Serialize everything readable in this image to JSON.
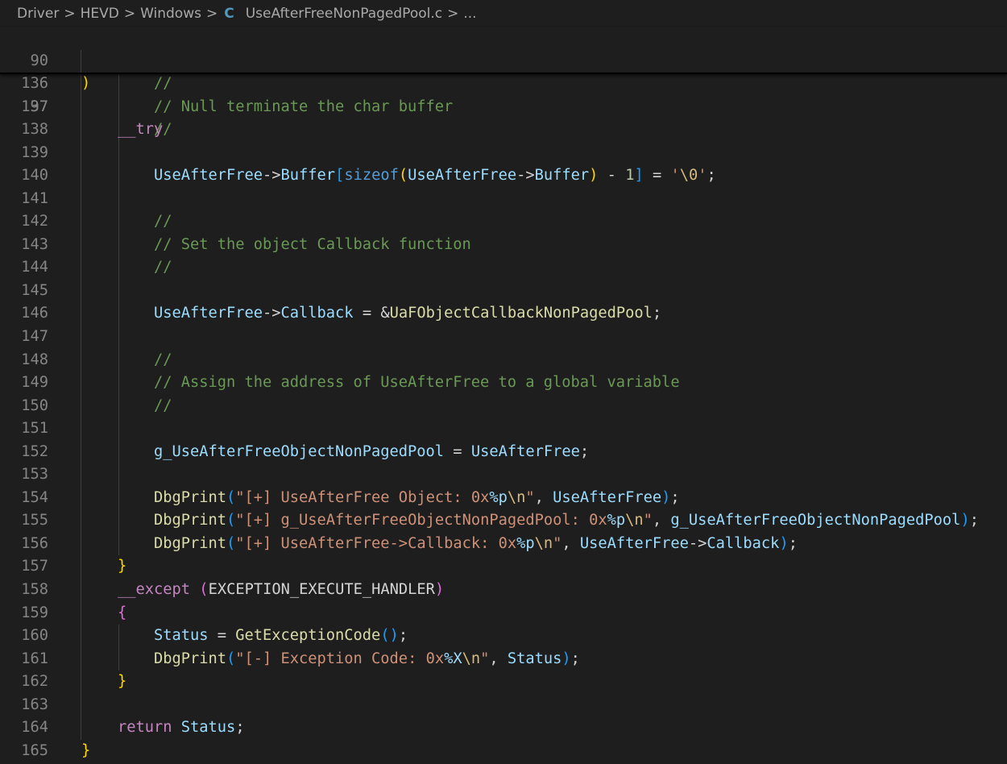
{
  "breadcrumb": {
    "items": [
      "Driver",
      "HEVD",
      "Windows"
    ],
    "file_icon": "C",
    "file": "UseAfterFreeNonPagedPool.c",
    "trailing": "...",
    "separator": ">"
  },
  "sticky": [
    {
      "num": "90",
      "code": ")"
    },
    {
      "num": "97",
      "code": "    __try"
    }
  ],
  "lines": [
    {
      "num": "136",
      "code": "        //"
    },
    {
      "num": "137",
      "code": "        // Null terminate the char buffer"
    },
    {
      "num": "138",
      "code": "        //"
    },
    {
      "num": "139",
      "code": ""
    },
    {
      "num": "140",
      "code": "        UseAfterFree->Buffer[sizeof(UseAfterFree->Buffer) - 1] = '\\0';"
    },
    {
      "num": "141",
      "code": ""
    },
    {
      "num": "142",
      "code": "        //"
    },
    {
      "num": "143",
      "code": "        // Set the object Callback function"
    },
    {
      "num": "144",
      "code": "        //"
    },
    {
      "num": "145",
      "code": ""
    },
    {
      "num": "146",
      "code": "        UseAfterFree->Callback = &UaFObjectCallbackNonPagedPool;"
    },
    {
      "num": "147",
      "code": ""
    },
    {
      "num": "148",
      "code": "        //"
    },
    {
      "num": "149",
      "code": "        // Assign the address of UseAfterFree to a global variable"
    },
    {
      "num": "150",
      "code": "        //"
    },
    {
      "num": "151",
      "code": ""
    },
    {
      "num": "152",
      "code": "        g_UseAfterFreeObjectNonPagedPool = UseAfterFree;"
    },
    {
      "num": "153",
      "code": ""
    },
    {
      "num": "154",
      "code": "        DbgPrint(\"[+] UseAfterFree Object: 0x%p\\n\", UseAfterFree);"
    },
    {
      "num": "155",
      "code": "        DbgPrint(\"[+] g_UseAfterFreeObjectNonPagedPool: 0x%p\\n\", g_UseAfterFreeObjectNonPagedPool);"
    },
    {
      "num": "156",
      "code": "        DbgPrint(\"[+] UseAfterFree->Callback: 0x%p\\n\", UseAfterFree->Callback);"
    },
    {
      "num": "157",
      "code": "    }"
    },
    {
      "num": "158",
      "code": "    __except (EXCEPTION_EXECUTE_HANDLER)"
    },
    {
      "num": "159",
      "code": "    {"
    },
    {
      "num": "160",
      "code": "        Status = GetExceptionCode();"
    },
    {
      "num": "161",
      "code": "        DbgPrint(\"[-] Exception Code: 0x%X\\n\", Status);"
    },
    {
      "num": "162",
      "code": "    }"
    },
    {
      "num": "163",
      "code": ""
    },
    {
      "num": "164",
      "code": "    return Status;"
    },
    {
      "num": "165",
      "code": "}"
    }
  ],
  "colors": {
    "background": "#1e1e1e",
    "line_number": "#858585",
    "comment": "#6a9955",
    "variable": "#9cdcfe",
    "function": "#dcdcaa",
    "string": "#ce9178",
    "keyword": "#569cd6",
    "control": "#c586c0",
    "number": "#b5cea8",
    "bracket_1": "#ffd700",
    "bracket_2": "#da70d6",
    "bracket_3": "#179fff"
  }
}
